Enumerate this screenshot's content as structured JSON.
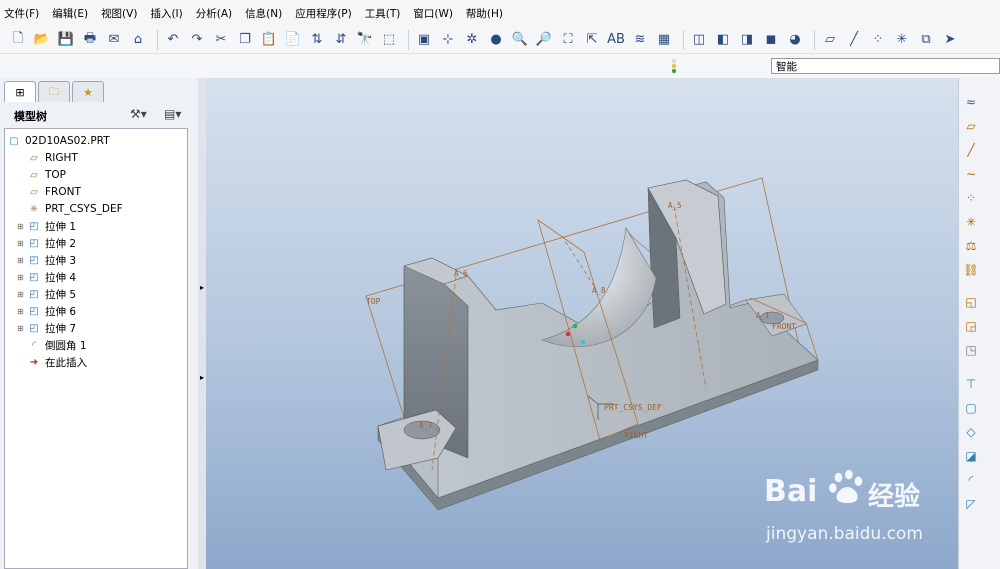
{
  "menu": [
    "文件(F)",
    "编辑(E)",
    "视图(V)",
    "插入(I)",
    "分析(A)",
    "信息(N)",
    "应用程序(P)",
    "工具(T)",
    "窗口(W)",
    "帮助(H)"
  ],
  "filter": {
    "value": "智能"
  },
  "model_tree": {
    "title": "模型树",
    "items": [
      {
        "label": "02D10AS02.PRT",
        "type": "part"
      },
      {
        "label": "RIGHT",
        "type": "plane"
      },
      {
        "label": "TOP",
        "type": "plane"
      },
      {
        "label": "FRONT",
        "type": "plane"
      },
      {
        "label": "PRT_CSYS_DEF",
        "type": "csys"
      },
      {
        "label": "拉伸 1",
        "type": "extrude"
      },
      {
        "label": "拉伸 2",
        "type": "extrude"
      },
      {
        "label": "拉伸 3",
        "type": "extrude"
      },
      {
        "label": "拉伸 4",
        "type": "extrude"
      },
      {
        "label": "拉伸 5",
        "type": "extrude"
      },
      {
        "label": "拉伸 6",
        "type": "extrude"
      },
      {
        "label": "拉伸 7",
        "type": "extrude"
      },
      {
        "label": "倒圆角 1",
        "type": "round"
      },
      {
        "label": "在此插入",
        "type": "insert"
      }
    ]
  },
  "viewport": {
    "labels": {
      "top": "TOP",
      "front": "FRONT",
      "right": "RIGHT",
      "csys": "PRT_CSYS_DEF",
      "a1": "A_1",
      "a5": "A_5",
      "a6": "A_6",
      "a7": "A_7",
      "a8": "A_8"
    }
  },
  "watermark": {
    "brand_latin": "Bai",
    "brand_cn": "经验",
    "url": "jingyan.baidu.com"
  }
}
